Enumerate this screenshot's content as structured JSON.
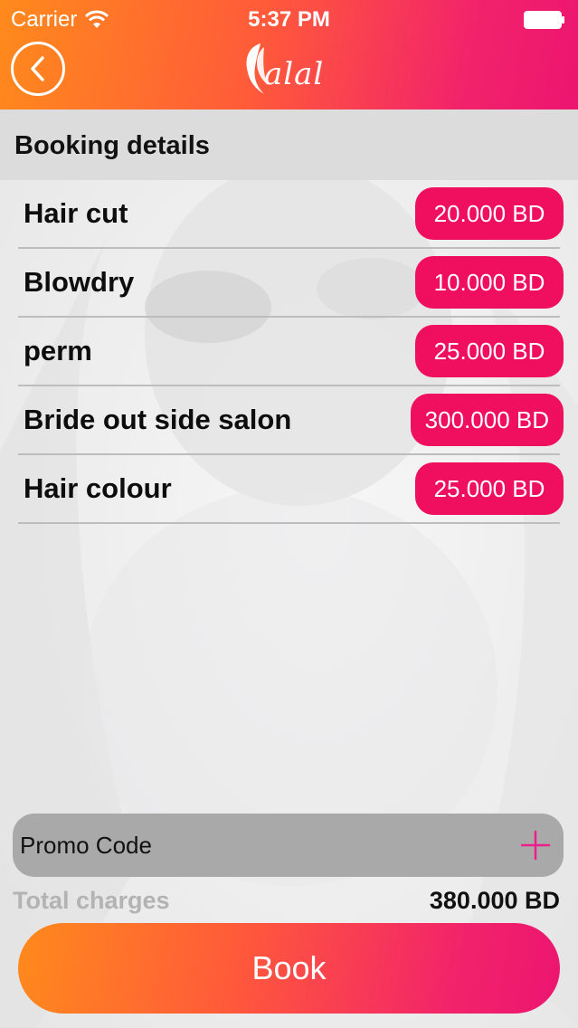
{
  "status_bar": {
    "carrier": "Carrier",
    "time": "5:37 PM"
  },
  "header": {
    "back_icon": "chevron-left-icon",
    "logo_text": "alal"
  },
  "section": {
    "title": "Booking details"
  },
  "services": [
    {
      "name": "Hair cut",
      "price": "20.000 BD"
    },
    {
      "name": "Blowdry",
      "price": "10.000 BD"
    },
    {
      "name": "perm",
      "price": "25.000 BD"
    },
    {
      "name": "Bride out side salon",
      "price": "300.000 BD"
    },
    {
      "name": "Hair colour",
      "price": "25.000 BD"
    }
  ],
  "promo": {
    "label": "Promo Code",
    "icon": "plus-icon"
  },
  "total": {
    "label": "Total charges",
    "value": "380.000 BD"
  },
  "book": {
    "label": "Book"
  },
  "colors": {
    "gradient_start": "#ff8a1c",
    "gradient_end": "#ec1570",
    "price_badge": "#ef0f5e",
    "promo_bg": "#a9a9aa",
    "plus_icon": "#ec1e8c"
  }
}
